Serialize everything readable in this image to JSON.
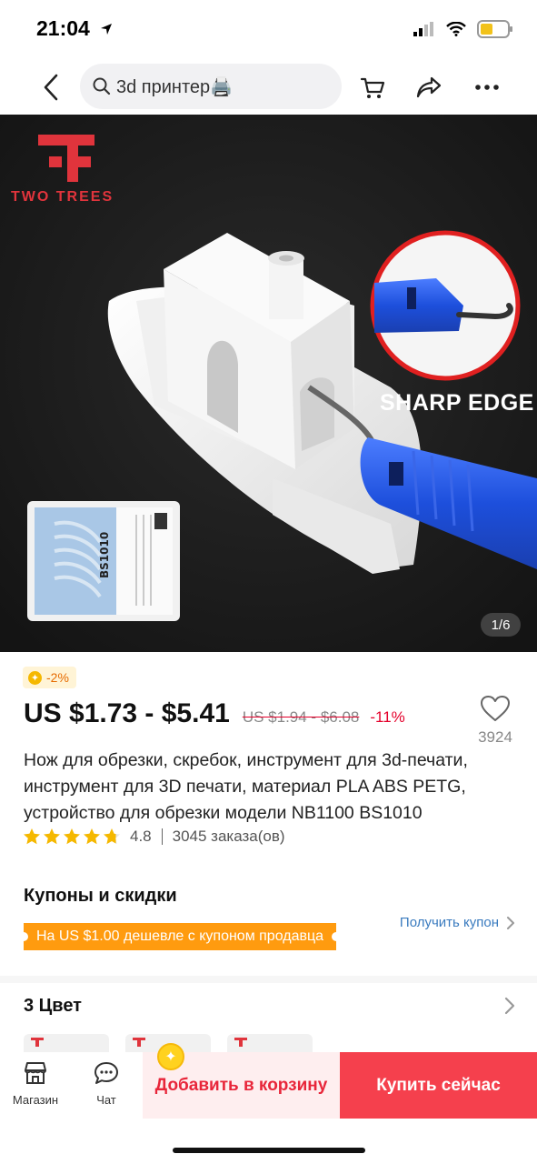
{
  "status_bar": {
    "time": "21:04"
  },
  "search": {
    "query": "3d принтер🖨️"
  },
  "product_image": {
    "brand_text": "TWO TREES",
    "caption": "SHARP EDGE",
    "counter": "1/6",
    "pack_label": "BS1010"
  },
  "badge": {
    "text": "-2%"
  },
  "price": {
    "range": "US $1.73 - $5.41",
    "old": "US $1.94 - $6.08",
    "discount": "-11%"
  },
  "wishlist": {
    "count": "3924"
  },
  "product": {
    "title": "Нож для обрезки, скребок, инструмент для 3d-печати, инструмент для 3D печати, материал PLA ABS PETG, устройство для обрезки модели NB1100 BS1010",
    "rating": "4.8",
    "orders": "3045 заказа(ов)"
  },
  "coupons": {
    "title": "Купоны и скидки",
    "banner": "На US $1.00 дешевле с купоном продавца",
    "get_coupon": "Получить купон"
  },
  "color": {
    "title": "3 Цвет"
  },
  "bottom_bar": {
    "store_label": "Магазин",
    "chat_label": "Чат",
    "add_to_cart": "Добавить в корзину",
    "buy_now": "Купить сейчас"
  },
  "colors": {
    "accent": "#f5404d",
    "coupon_orange": "#ff9b0f",
    "link_blue": "#3a7bbf",
    "star": "#f5b800",
    "discount_red": "#e4002b"
  }
}
